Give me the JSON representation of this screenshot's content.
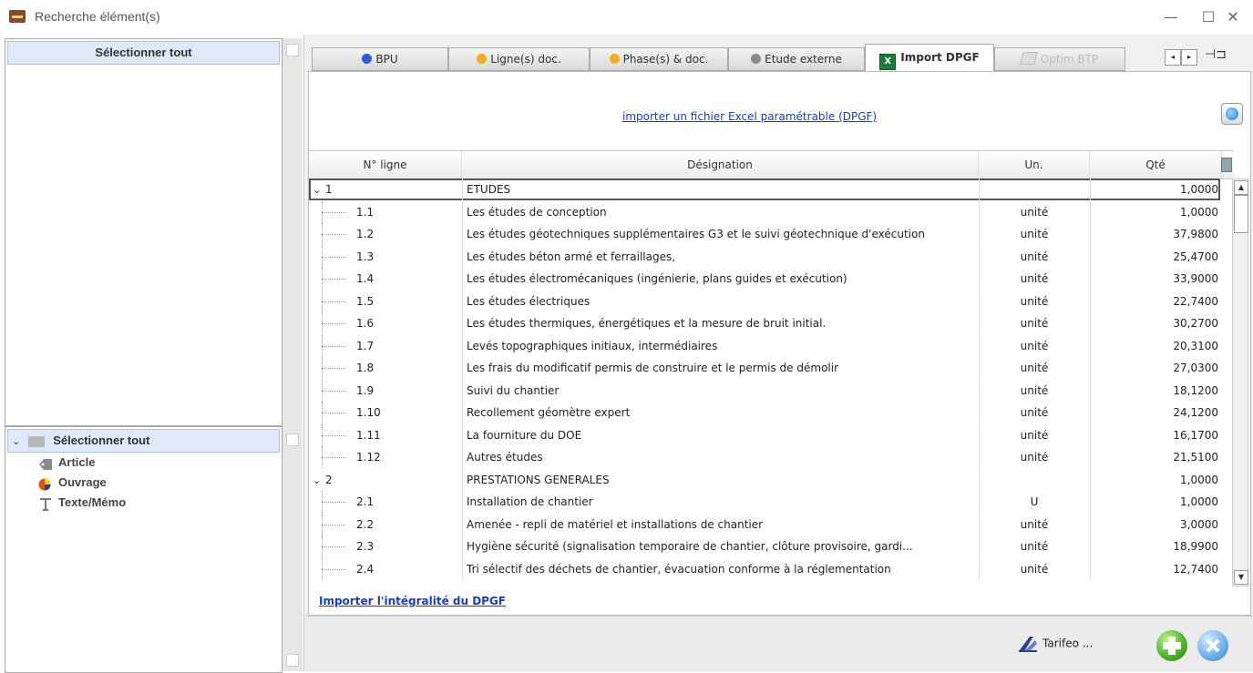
{
  "window": {
    "title": "Recherche élément(s)",
    "controls": [
      "—",
      "☐",
      "✕"
    ]
  },
  "left": {
    "top_select_all": "Sélectionner tout",
    "bottom_select_all": "Sélectionner tout",
    "tree": [
      {
        "label": "Article",
        "icon": "tag-icon"
      },
      {
        "label": "Ouvrage",
        "icon": "colored-disc-icon"
      },
      {
        "label": "Texte/Mémo",
        "icon": "text-t-icon"
      }
    ]
  },
  "tabs": [
    {
      "label": "BPU",
      "dot": "#2a5fd8"
    },
    {
      "label": "Ligne(s) doc.",
      "dot": "#f0b020"
    },
    {
      "label": "Phase(s) & doc.",
      "dot": "#f0b020"
    },
    {
      "label": "Etude externe",
      "dot": "#8a8a8a"
    },
    {
      "label": "Import DPGF",
      "icon": "excel-icon"
    },
    {
      "label": "Optim BTP",
      "icon": "optim-icon"
    }
  ],
  "import_link": "importer un fichier Excel paramétrable (DPGF)",
  "grid": {
    "headers": [
      "N° ligne",
      "Désignation",
      "Un.",
      "Qté"
    ],
    "rows": [
      {
        "num": "1",
        "des": "ETUDES",
        "un": "",
        "qte": "1,0000",
        "group": true
      },
      {
        "num": "1.1",
        "des": "Les études de conception",
        "un": "unité",
        "qte": "1,0000"
      },
      {
        "num": "1.2",
        "des": "Les études géotechniques supplémentaires G3 et le suivi géotechnique d'exécution",
        "un": "unité",
        "qte": "37,9800"
      },
      {
        "num": "1.3",
        "des": "Les études béton armé et ferraillages,",
        "un": "unité",
        "qte": "25,4700"
      },
      {
        "num": "1.4",
        "des": "Les études électromécaniques (ingénierie, plans guides et exécution)",
        "un": "unité",
        "qte": "33,9000"
      },
      {
        "num": "1.5",
        "des": "Les études électriques",
        "un": "unité",
        "qte": "22,7400"
      },
      {
        "num": "1.6",
        "des": "Les études thermiques, énergétiques et  la mesure de bruit initial.",
        "un": "unité",
        "qte": "30,2700"
      },
      {
        "num": "1.7",
        "des": "Levés topographiques initiaux, intermédiaires",
        "un": "unité",
        "qte": "20,3100"
      },
      {
        "num": "1.8",
        "des": "Les  frais du modificatif permis de construire et le permis de démolir",
        "un": "unité",
        "qte": "27,0300"
      },
      {
        "num": "1.9",
        "des": "Suivi du chantier",
        "un": "unité",
        "qte": "18,1200"
      },
      {
        "num": "1.10",
        "des": "Recollement géomètre expert",
        "un": "unité",
        "qte": "24,1200"
      },
      {
        "num": "1.11",
        "des": "La fourniture du DOE",
        "un": "unité",
        "qte": "16,1700"
      },
      {
        "num": "1.12",
        "des": "Autres études",
        "un": "unité",
        "qte": "21,5100"
      },
      {
        "num": "2",
        "des": "PRESTATIONS GENERALES",
        "un": "",
        "qte": "1,0000",
        "group": true
      },
      {
        "num": "2.1",
        "des": "Installation de chantier",
        "un": "U",
        "qte": "1,0000"
      },
      {
        "num": "2.2",
        "des": "Amenée - repli de matériel et installations de chantier",
        "un": "unité",
        "qte": "3,0000"
      },
      {
        "num": "2.3",
        "des": "Hygiène sécurité (signalisation temporaire de chantier, clôture provisoire, gardi...",
        "un": "unité",
        "qte": "18,9900"
      },
      {
        "num": "2.4",
        "des": "Tri sélectif des déchets de chantier, évacuation conforme à la réglementation",
        "un": "unité",
        "qte": "12,7400"
      }
    ]
  },
  "import_all_link": "Importer l'intégralité du DPGF",
  "footer": {
    "tarifeo": "Tarifeo ..."
  }
}
